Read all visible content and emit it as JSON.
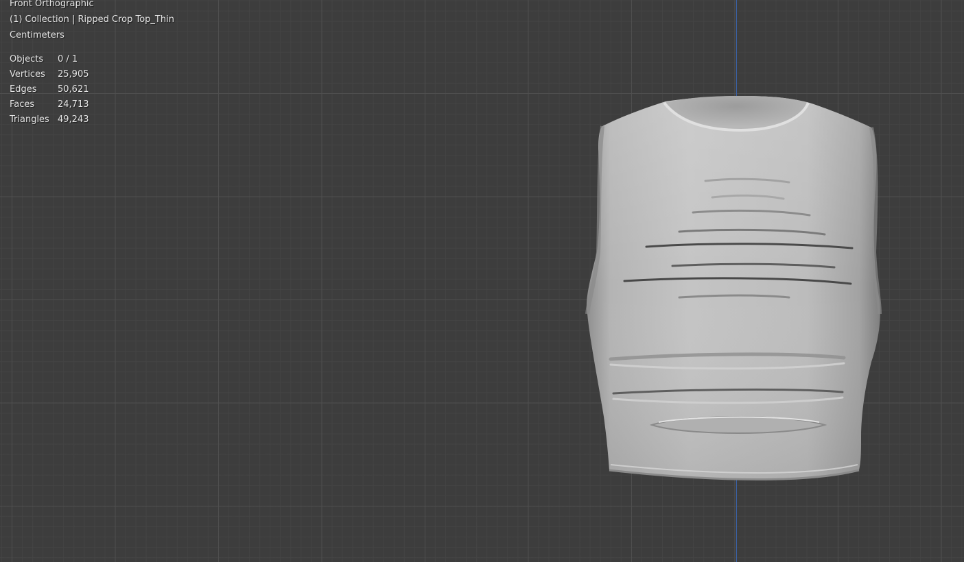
{
  "viewport": {
    "view_name": "Front Orthographic",
    "collection_label": "(1) Collection | Ripped Crop Top_Thin",
    "units": "Centimeters",
    "background_color": "#3d3d3d",
    "axis_line_color": "#3a62a8",
    "object_icon": "crop-top-mesh-icon"
  },
  "statistics": {
    "objects": {
      "label": "Objects",
      "value": "0 / 1"
    },
    "vertices": {
      "label": "Vertices",
      "value": "25,905"
    },
    "edges": {
      "label": "Edges",
      "value": "50,621"
    },
    "faces": {
      "label": "Faces",
      "value": "24,713"
    },
    "triangles": {
      "label": "Triangles",
      "value": "49,243"
    }
  }
}
